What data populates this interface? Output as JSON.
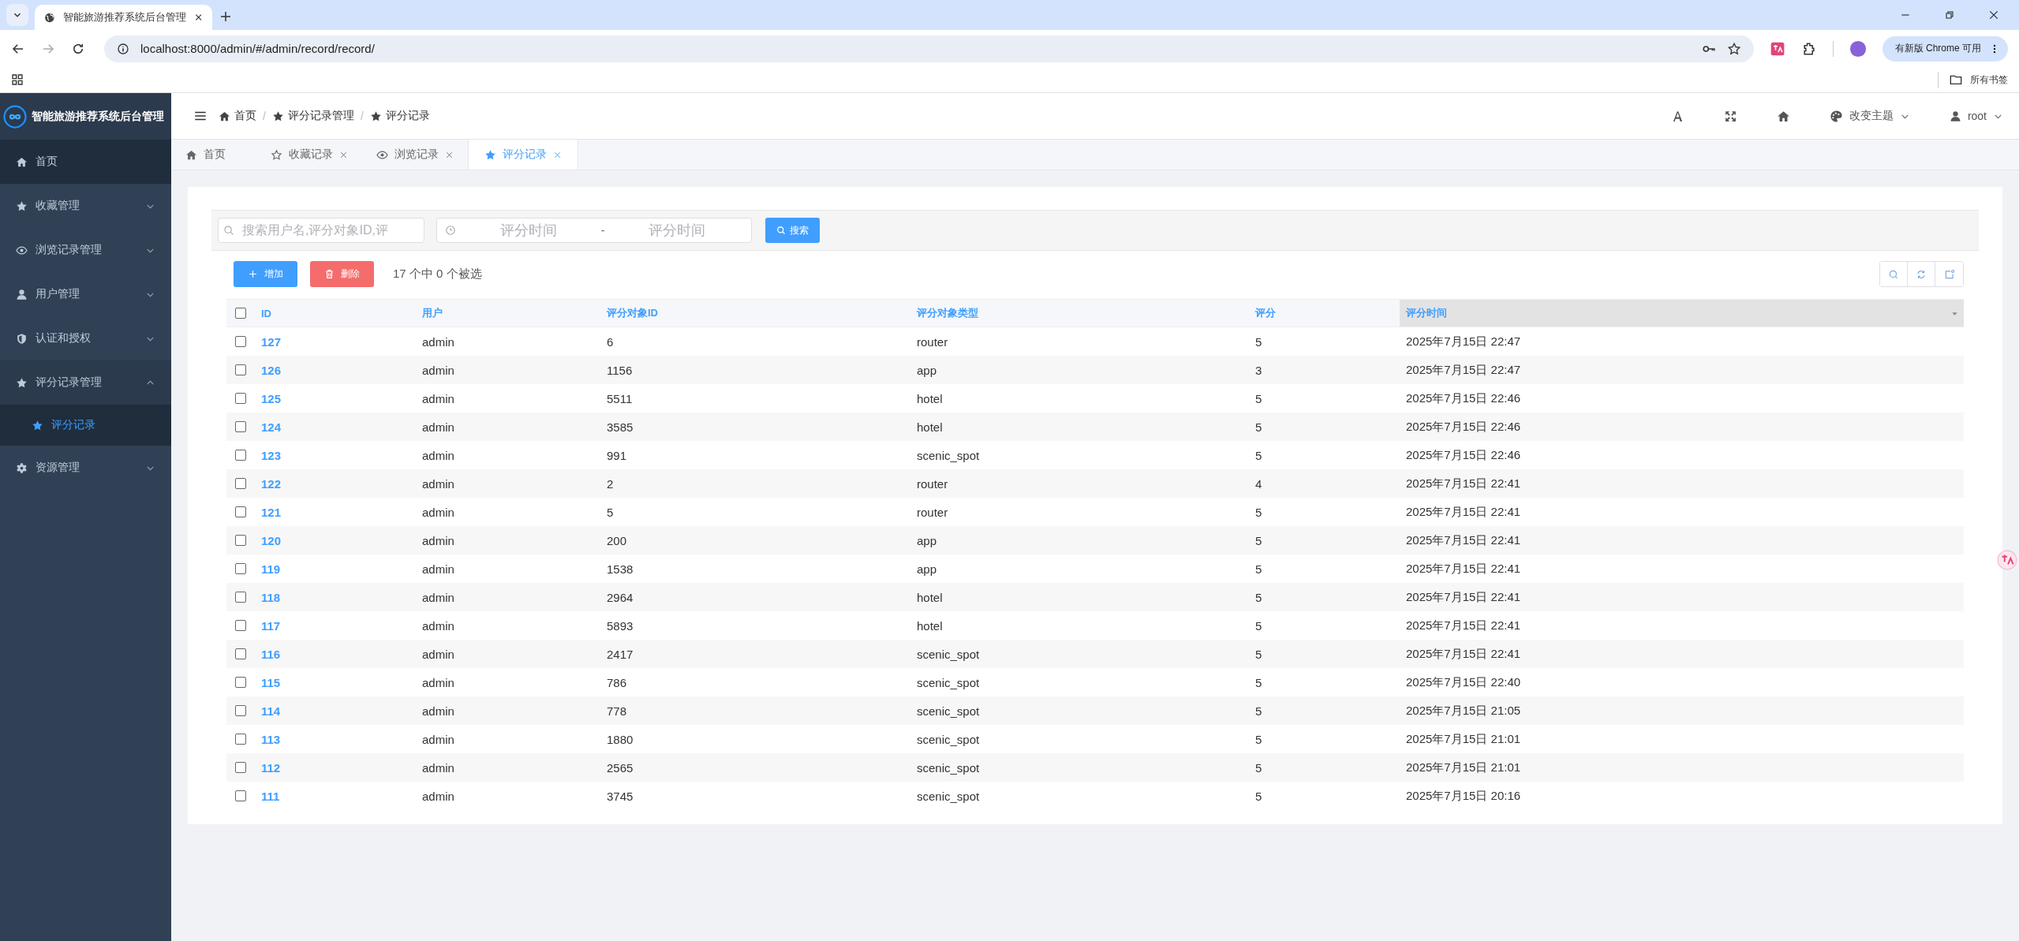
{
  "browser": {
    "tab_title": "智能旅游推荐系统后台管理",
    "url": "localhost:8000/admin/#/admin/record/record/",
    "update_button": "有新版 Chrome 可用",
    "bookmarks_label": "所有书签"
  },
  "sidebar": {
    "title": "智能旅游推荐系统后台管理",
    "items": [
      {
        "label": "首页",
        "kind": "link"
      },
      {
        "label": "收藏管理",
        "kind": "group",
        "expanded": false
      },
      {
        "label": "浏览记录管理",
        "kind": "group",
        "expanded": false
      },
      {
        "label": "用户管理",
        "kind": "group",
        "expanded": false
      },
      {
        "label": "认证和授权",
        "kind": "group",
        "expanded": false
      },
      {
        "label": "评分记录管理",
        "kind": "group",
        "expanded": true,
        "children": [
          {
            "label": "评分记录",
            "selected": true
          }
        ]
      },
      {
        "label": "资源管理",
        "kind": "group",
        "expanded": false
      }
    ]
  },
  "breadcrumb": [
    {
      "label": "首页",
      "separator": "/"
    },
    {
      "label": "评分记录管理",
      "separator": "/"
    },
    {
      "label": "评分记录"
    }
  ],
  "header": {
    "theme_label": "改变主题",
    "user": "root"
  },
  "tabs": [
    {
      "label": "首页",
      "closable": false,
      "selected": false
    },
    {
      "label": "收藏记录",
      "closable": true,
      "selected": false
    },
    {
      "label": "浏览记录",
      "closable": true,
      "selected": false
    },
    {
      "label": "评分记录",
      "closable": true,
      "selected": true
    }
  ],
  "search": {
    "placeholder": "搜索用户名,评分对象ID,评",
    "date_start_placeholder": "评分时间",
    "date_separator": "-",
    "date_end_placeholder": "评分时间",
    "button": "搜索"
  },
  "actions": {
    "add": "增加",
    "delete": "删除",
    "selection_count": "17 个中 0 个被选"
  },
  "table": {
    "header_checked": false,
    "columns": [
      {
        "label": "ID",
        "sorted": false
      },
      {
        "label": "用户",
        "sorted": false
      },
      {
        "label": "评分对象ID",
        "sorted": false
      },
      {
        "label": "评分对象类型",
        "sorted": false
      },
      {
        "label": "评分",
        "sorted": false
      },
      {
        "label": "评分时间",
        "sorted": true
      }
    ],
    "rows": [
      {
        "selected": false,
        "cells": [
          "127",
          "admin",
          "6",
          "router",
          "5",
          "2025年7月15日 22:47"
        ]
      },
      {
        "selected": false,
        "cells": [
          "126",
          "admin",
          "1156",
          "app",
          "3",
          "2025年7月15日 22:47"
        ]
      },
      {
        "selected": false,
        "cells": [
          "125",
          "admin",
          "5511",
          "hotel",
          "5",
          "2025年7月15日 22:46"
        ]
      },
      {
        "selected": false,
        "cells": [
          "124",
          "admin",
          "3585",
          "hotel",
          "5",
          "2025年7月15日 22:46"
        ]
      },
      {
        "selected": false,
        "cells": [
          "123",
          "admin",
          "991",
          "scenic_spot",
          "5",
          "2025年7月15日 22:46"
        ]
      },
      {
        "selected": false,
        "cells": [
          "122",
          "admin",
          "2",
          "router",
          "4",
          "2025年7月15日 22:41"
        ]
      },
      {
        "selected": false,
        "cells": [
          "121",
          "admin",
          "5",
          "router",
          "5",
          "2025年7月15日 22:41"
        ]
      },
      {
        "selected": false,
        "cells": [
          "120",
          "admin",
          "200",
          "app",
          "5",
          "2025年7月15日 22:41"
        ]
      },
      {
        "selected": false,
        "cells": [
          "119",
          "admin",
          "1538",
          "app",
          "5",
          "2025年7月15日 22:41"
        ]
      },
      {
        "selected": false,
        "cells": [
          "118",
          "admin",
          "2964",
          "hotel",
          "5",
          "2025年7月15日 22:41"
        ]
      },
      {
        "selected": false,
        "cells": [
          "117",
          "admin",
          "5893",
          "hotel",
          "5",
          "2025年7月15日 22:41"
        ]
      },
      {
        "selected": false,
        "cells": [
          "116",
          "admin",
          "2417",
          "scenic_spot",
          "5",
          "2025年7月15日 22:41"
        ]
      },
      {
        "selected": false,
        "cells": [
          "115",
          "admin",
          "786",
          "scenic_spot",
          "5",
          "2025年7月15日 22:40"
        ]
      },
      {
        "selected": false,
        "cells": [
          "114",
          "admin",
          "778",
          "scenic_spot",
          "5",
          "2025年7月15日 21:05"
        ]
      },
      {
        "selected": false,
        "cells": [
          "113",
          "admin",
          "1880",
          "scenic_spot",
          "5",
          "2025年7月15日 21:01"
        ]
      },
      {
        "selected": false,
        "cells": [
          "112",
          "admin",
          "2565",
          "scenic_spot",
          "5",
          "2025年7月15日 21:01"
        ]
      },
      {
        "selected": false,
        "cells": [
          "111",
          "admin",
          "3745",
          "scenic_spot",
          "5",
          "2025年7月15日 20:16"
        ]
      }
    ]
  }
}
